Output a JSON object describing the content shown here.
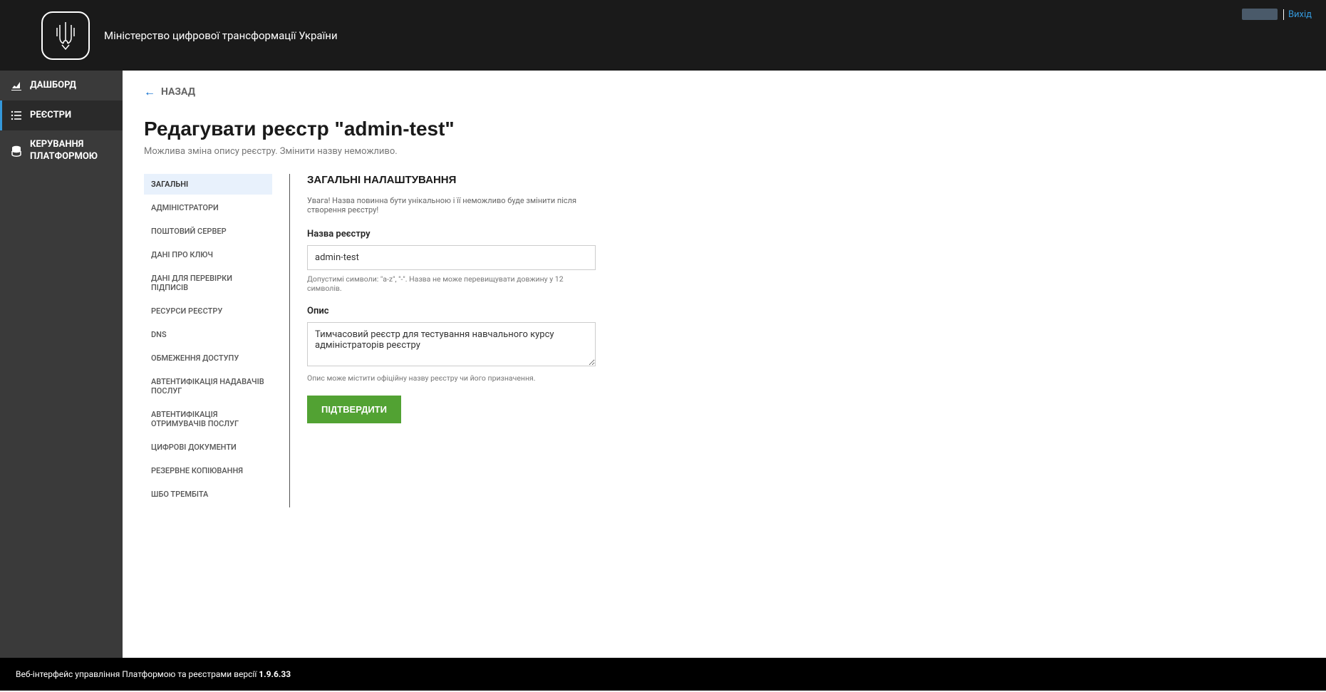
{
  "header": {
    "title": "Міністерство цифрової трансформації України",
    "logout": "Вихід"
  },
  "sidebar": {
    "items": [
      {
        "label": "ДАШБОРД"
      },
      {
        "label": "РЕЄСТРИ"
      },
      {
        "label": "КЕРУВАННЯ ПЛАТФОРМОЮ"
      }
    ]
  },
  "main": {
    "back_label": "НАЗАД",
    "title": "Редагувати реєстр \"admin-test\"",
    "subtitle": "Можлива зміна опису реєстру. Змінити назву неможливо."
  },
  "tabs": [
    "ЗАГАЛЬНІ",
    "АДМІНІСТРАТОРИ",
    "ПОШТОВИЙ СЕРВЕР",
    "ДАНІ ПРО КЛЮЧ",
    "ДАНІ ДЛЯ ПЕРЕВІРКИ ПІДПИСІВ",
    "РЕСУРСИ РЕЄСТРУ",
    "DNS",
    "ОБМЕЖЕННЯ ДОСТУПУ",
    "АВТЕНТИФІКАЦІЯ НАДАВАЧІВ ПОСЛУГ",
    "АВТЕНТИФІКАЦІЯ ОТРИМУВАЧІВ ПОСЛУГ",
    "ЦИФРОВІ ДОКУМЕНТИ",
    "РЕЗЕРВНЕ КОПІЮВАННЯ",
    "ШБО ТРЕМБІТА"
  ],
  "form": {
    "heading": "ЗАГАЛЬНІ НАЛАШТУВАННЯ",
    "warning": "Увага! Назва повинна бути унікальною і її неможливо буде змінити після створення реєстру!",
    "name_label": "Назва реєстру",
    "name_value": "admin-test",
    "name_hint": "Допустимі символи: \"a-z\", \"-\". Назва не може перевищувати довжину у 12 символів.",
    "desc_label": "Опис",
    "desc_value": "Тимчасовий реєстр для тестування навчального курсу адміністраторів реєстру",
    "desc_hint": "Опис може містити офіційну назву реєстру чи його призначення.",
    "submit": "ПІДТВЕРДИТИ"
  },
  "footer": {
    "text": "Веб-інтерфейс управління Платформою та реєстрами версії ",
    "version": "1.9.6.33"
  }
}
